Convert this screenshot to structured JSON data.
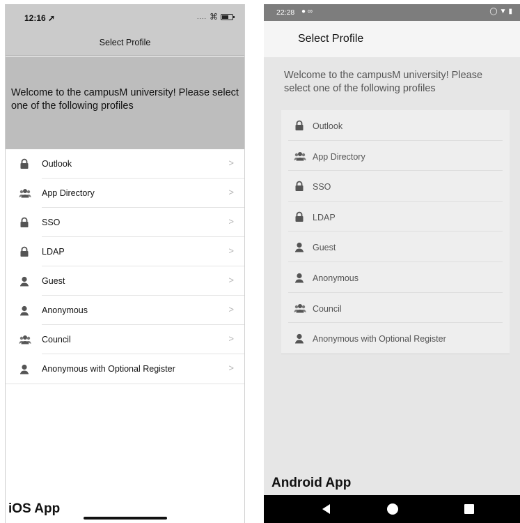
{
  "ios": {
    "status_time": "12:16",
    "status_signal": "....",
    "nav_title": "Select Profile",
    "welcome": "Welcome to the campusM university! Please select one of the following profiles",
    "chevron": ">",
    "items": [
      {
        "label": "Outlook",
        "icon": "lock-icon"
      },
      {
        "label": "App Directory",
        "icon": "group-icon"
      },
      {
        "label": "SSO",
        "icon": "lock-icon"
      },
      {
        "label": "LDAP",
        "icon": "lock-icon"
      },
      {
        "label": "Guest",
        "icon": "person-icon"
      },
      {
        "label": "Anonymous",
        "icon": "person-icon"
      },
      {
        "label": "Council",
        "icon": "group-icon"
      },
      {
        "label": "Anonymous with Optional Register",
        "icon": "person-icon"
      }
    ],
    "caption": "iOS App"
  },
  "android": {
    "status_time": "22:28",
    "title": "Select Profile",
    "welcome": "Welcome to the campusM university! Please select one of the following profiles",
    "items": [
      {
        "label": "Outlook",
        "icon": "lock-icon"
      },
      {
        "label": "App Directory",
        "icon": "group-icon"
      },
      {
        "label": "SSO",
        "icon": "lock-icon"
      },
      {
        "label": "LDAP",
        "icon": "lock-icon"
      },
      {
        "label": "Guest",
        "icon": "person-icon"
      },
      {
        "label": "Anonymous",
        "icon": "person-icon"
      },
      {
        "label": "Council",
        "icon": "group-icon"
      },
      {
        "label": "Anonymous with Optional Register",
        "icon": "person-icon"
      }
    ],
    "caption": "Android App"
  },
  "colors": {
    "ios_header": "#cbcbcb",
    "ios_banner": "#bdbdbd",
    "android_status": "#7d7d7d",
    "android_bg": "#e6e6e6",
    "icon": "#555555"
  }
}
